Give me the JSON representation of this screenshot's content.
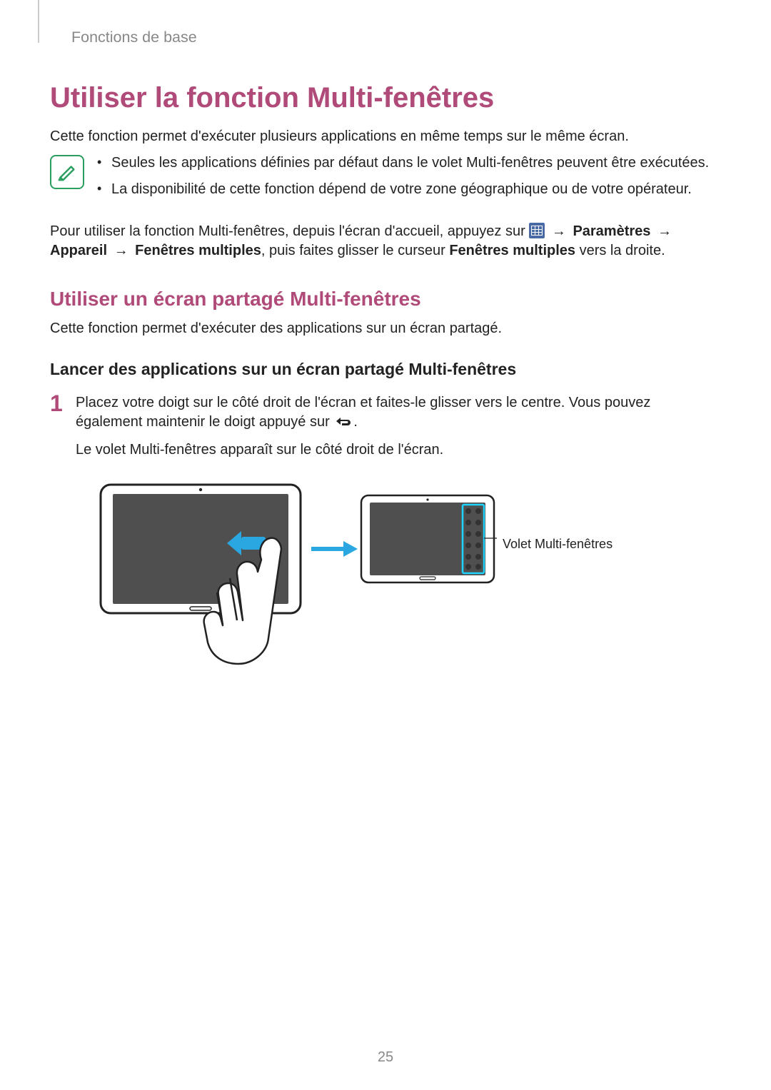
{
  "header": "Fonctions de base",
  "h1": "Utiliser la fonction Multi-fenêtres",
  "intro": "Cette fonction permet d'exécuter plusieurs applications en même temps sur le même écran.",
  "note": {
    "items": [
      "Seules les applications définies par défaut dans le volet Multi-fenêtres peuvent être exécutées.",
      "La disponibilité de cette fonction dépend de votre zone géographique ou de votre opérateur."
    ]
  },
  "enable": {
    "pre": "Pour utiliser la fonction Multi-fenêtres, depuis l'écran d'accueil, appuyez sur ",
    "arrow": "→",
    "p1_bold": "Paramètres",
    "line2_bold1": "Appareil",
    "line2_bold2": "Fenêtres multiples",
    "line2_mid": ", puis faites glisser le curseur ",
    "line2_bold3": "Fenêtres multiples",
    "line2_post": " vers la droite."
  },
  "h2": "Utiliser un écran partagé Multi-fenêtres",
  "h2_intro": "Cette fonction permet d'exécuter des applications sur un écran partagé.",
  "h3": "Lancer des applications sur un écran partagé Multi-fenêtres",
  "step": {
    "num": "1",
    "p1_pre": "Placez votre doigt sur le côté droit de l'écran et faites-le glisser vers le centre. Vous pouvez également maintenir le doigt appuyé sur ",
    "p1_post": ".",
    "p2": "Le volet Multi-fenêtres apparaît sur le côté droit de l'écran."
  },
  "callout": "Volet Multi-fenêtres",
  "page_number": "25"
}
